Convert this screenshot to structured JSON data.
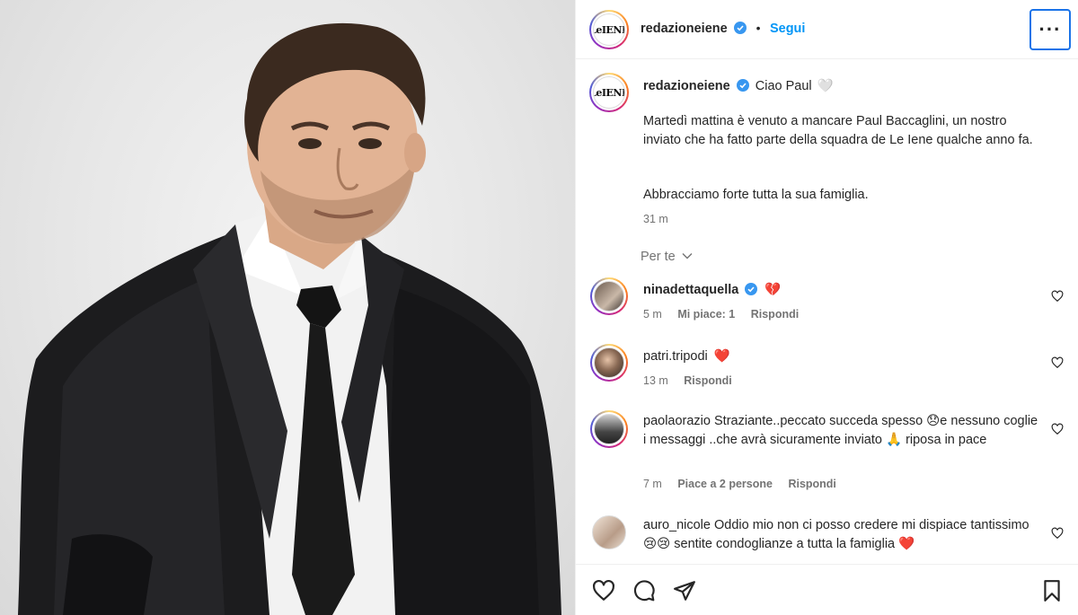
{
  "post": {
    "author": "redazioneiene",
    "follow_label": "Segui",
    "more_label": "···",
    "logo_text": "LeIENE",
    "caption": {
      "title": "Ciao Paul",
      "title_emoji": "🤍",
      "paragraph1": "Martedì mattina è venuto a mancare Paul Baccaglini, un nostro inviato che ha fatto parte della squadra de Le Iene qualche anno fa.",
      "paragraph2": "Abbracciamo forte tutta la sua famiglia.",
      "time": "31 m"
    },
    "section_label": "Per te"
  },
  "comments": [
    {
      "username": "ninadettaquella",
      "text": "💔",
      "time": "5 m",
      "likes": "Mi piace: 1",
      "reply": "Rispondi"
    },
    {
      "username": "patri.tripodi",
      "text": "❤️",
      "time": "13 m",
      "reply": "Rispondi"
    },
    {
      "username": "paolaorazio",
      "text": "Straziante..peccato succeda spesso 😞e nessuno coglie i messaggi ..che avrà sicuramente inviato 🙏 riposa in pace",
      "time": "7 m",
      "likes": "Piace a 2 persone",
      "reply": "Rispondi"
    },
    {
      "username": "auro_nicole",
      "text": "Oddio mio non ci posso credere mi dispiace tantissimo 😢😢 sentite condoglianze a tutta la famiglia ❤️"
    }
  ],
  "colors": {
    "follow_blue": "#0095f6",
    "verified_blue": "#3897f0",
    "muted_text": "#737373",
    "focus_border": "#1a73e8"
  },
  "icons": [
    "heart-icon",
    "comment-icon",
    "share-icon",
    "bookmark-icon",
    "verified-icon",
    "more-icon",
    "chevron-down-icon"
  ]
}
